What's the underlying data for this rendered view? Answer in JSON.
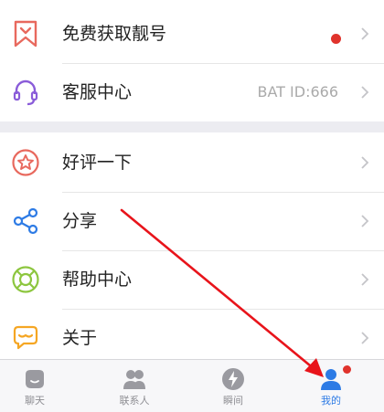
{
  "menu": {
    "group1": [
      {
        "label": "免费获取靓号",
        "icon": "bookmark-icon",
        "has_badge": true
      },
      {
        "label": "客服中心",
        "icon": "headset-icon",
        "meta": "BAT ID:666"
      }
    ],
    "group2": [
      {
        "label": "好评一下",
        "icon": "star-circle-icon"
      },
      {
        "label": "分享",
        "icon": "share-icon"
      },
      {
        "label": "帮助中心",
        "icon": "lifebuoy-icon"
      },
      {
        "label": "关于",
        "icon": "chat-bubble-icon"
      }
    ]
  },
  "tabbar": {
    "tabs": [
      {
        "label": "聊天",
        "icon": "chat-face-icon"
      },
      {
        "label": "联系人",
        "icon": "contacts-icon"
      },
      {
        "label": "瞬间",
        "icon": "lightning-icon"
      },
      {
        "label": "我的",
        "icon": "person-icon",
        "active": true,
        "has_badge": true
      }
    ]
  },
  "colors": {
    "accent": "#2d7be5",
    "badge": "#e0332c",
    "annotation_arrow": "#e8141b",
    "bookmark_icon": "#e8695e",
    "headset_icon": "#8a5cd9",
    "star_icon": "#e8695e",
    "share_icon": "#2d7be5",
    "lifebuoy_icon": "#8dc63f",
    "chat_icon": "#f5a623"
  }
}
